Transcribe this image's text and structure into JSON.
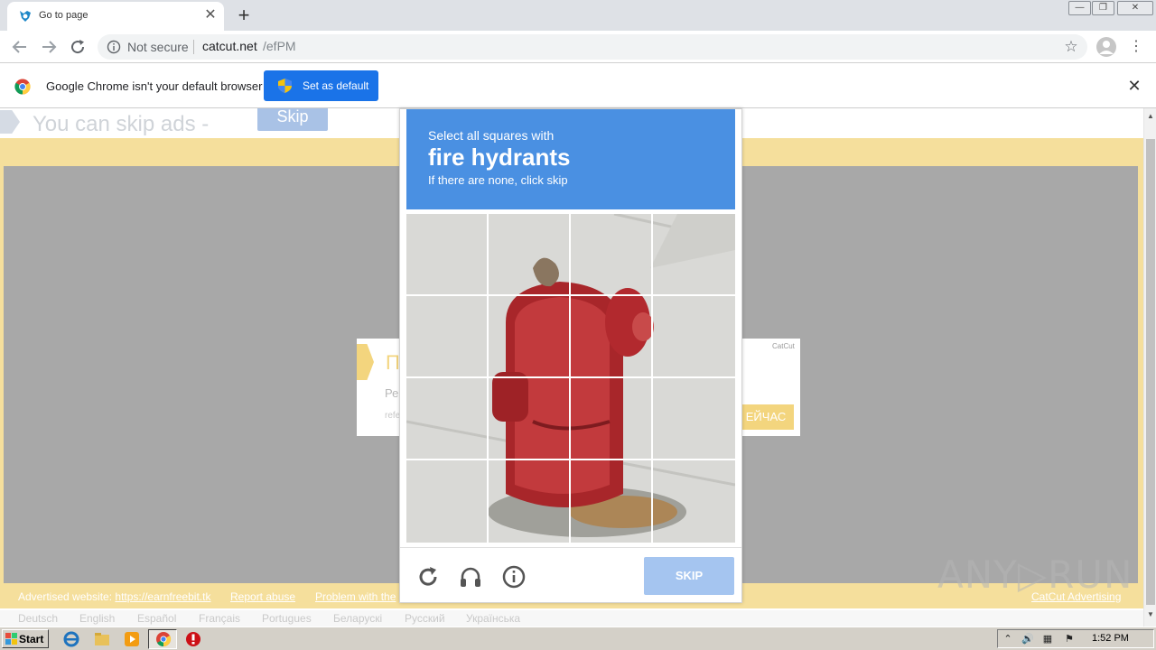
{
  "browser": {
    "tab": {
      "title": "Go to page",
      "close": "✕"
    },
    "new_tab": "+",
    "window_buttons": {
      "minimize": "—",
      "restore": "❐",
      "close": "✕"
    },
    "omnibox": {
      "security_label": "Not secure",
      "url_host": "catcut.net",
      "url_path": "/efPM",
      "star": "☆"
    },
    "menu": "⋮"
  },
  "infobar": {
    "message": "Google Chrome isn't your default browser",
    "button_label": "Set as default",
    "close": "✕"
  },
  "page": {
    "skip_ads_text": "You can skip ads  -",
    "skip_button": "Skip",
    "ad": {
      "title": "П",
      "subtitle": "Ре",
      "subtitle2": "refe",
      "brand": "CatCut",
      "button": "ЕЙЧАС"
    },
    "footer": {
      "advertised_prefix": "Advertised website: ",
      "advertised_link": "https://earnfreebit.tk",
      "report_abuse": "Report abuse",
      "problem": "Problem with the",
      "catcut": "CatCut Advertising"
    },
    "languages": [
      "Deutsch",
      "English",
      "Español",
      "Français",
      "Portugues",
      "Беларускі",
      "Русский",
      "Українська"
    ]
  },
  "captcha": {
    "line1": "Select all squares with",
    "line2": "fire hydrants",
    "line3": "If there are none, click skip",
    "skip_button": "SKIP",
    "colors": {
      "header": "#4a90e2",
      "skip": "#a5c5f0"
    }
  },
  "watermark": "ANY▷RUN",
  "taskbar": {
    "start": "Start",
    "time": "1:52 PM"
  }
}
